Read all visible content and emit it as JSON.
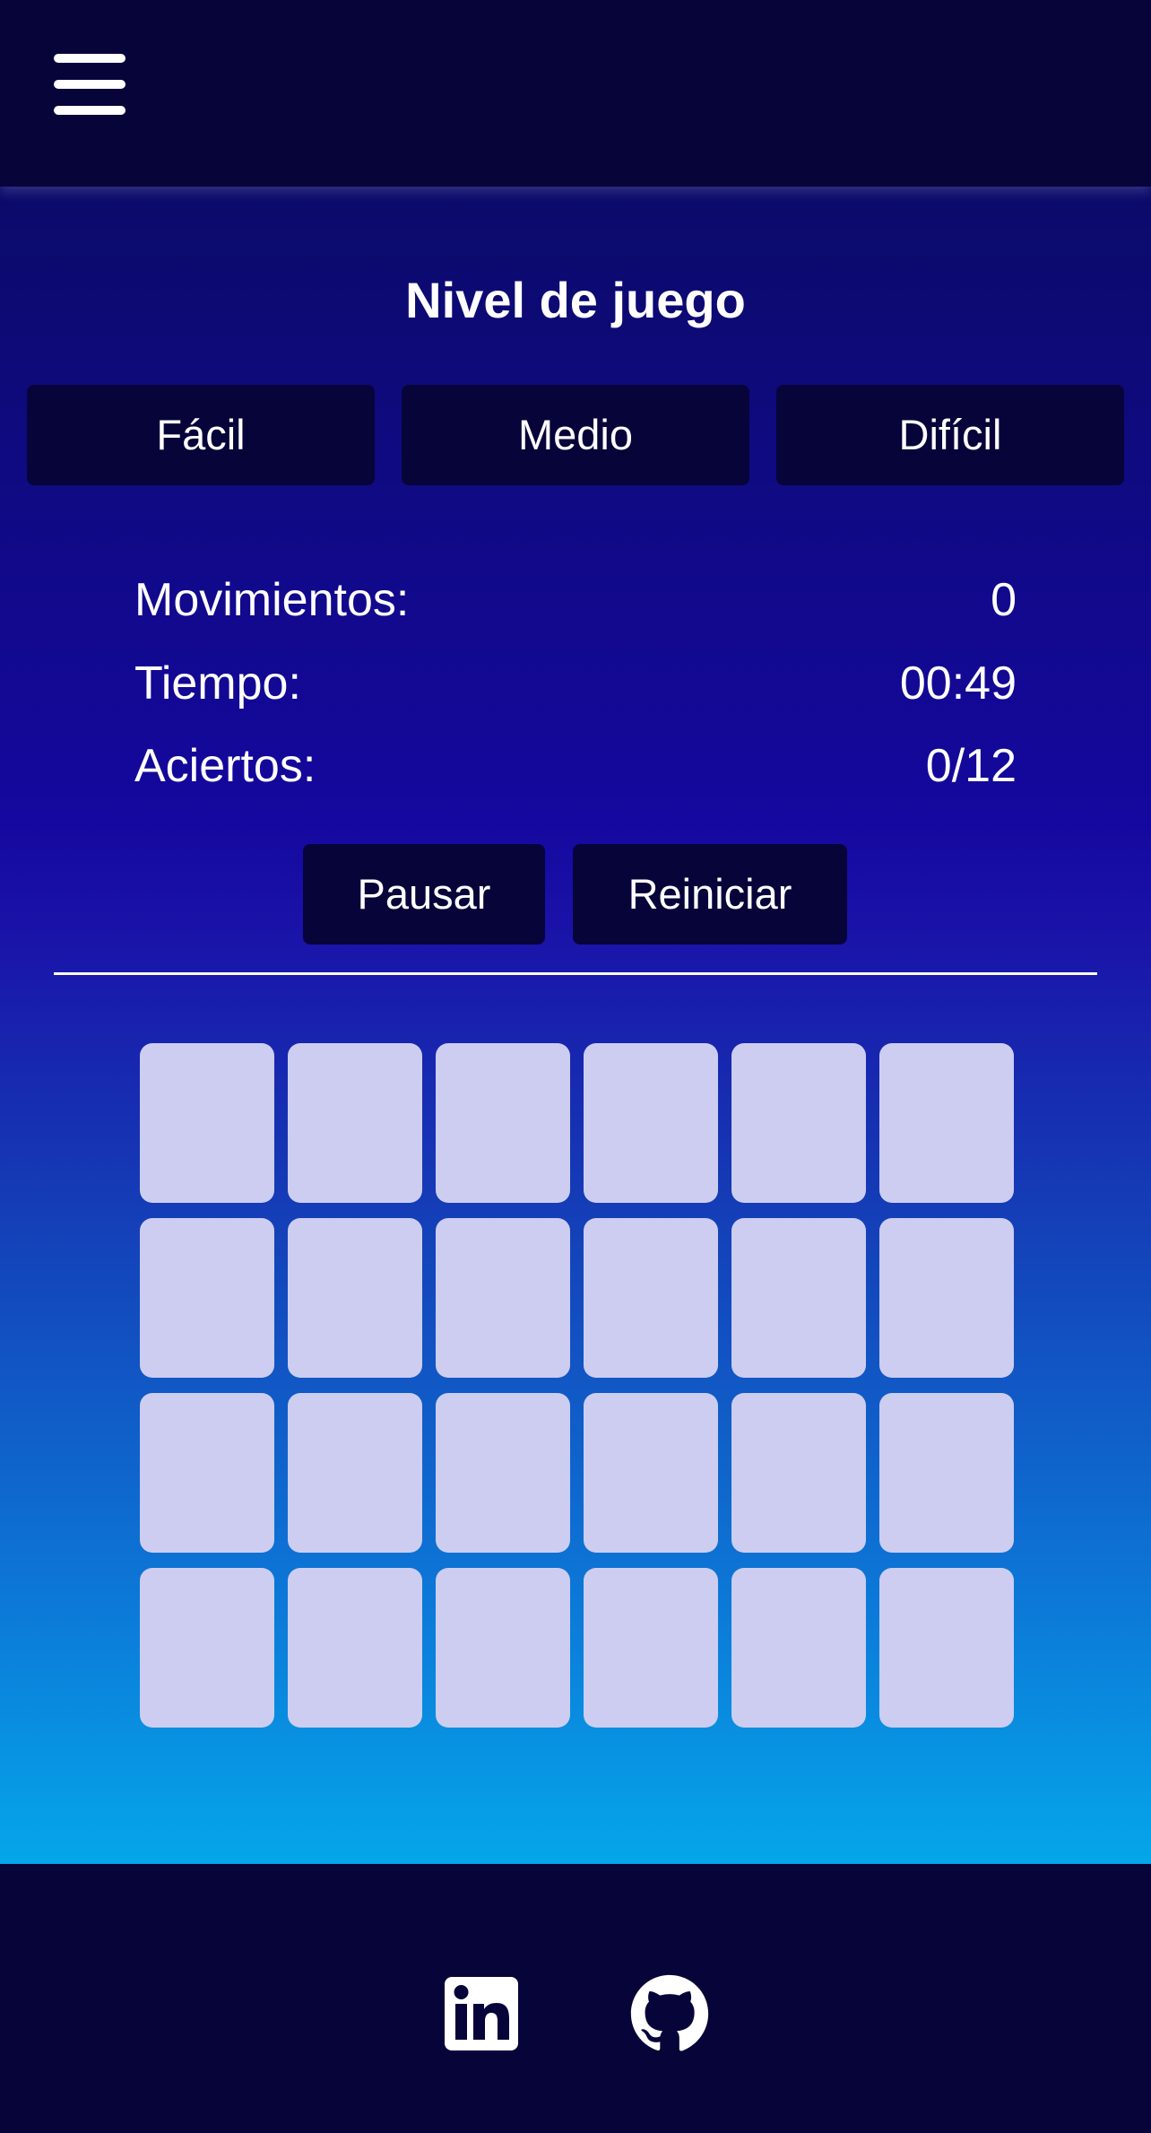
{
  "header": {
    "menu_icon": "hamburger-menu-icon"
  },
  "game": {
    "level_title": "Nivel de juego",
    "levels": [
      "Fácil",
      "Medio",
      "Difícil"
    ],
    "stats": {
      "moves_label": "Movimientos:",
      "moves_value": "0",
      "time_label": "Tiempo:",
      "time_value": "00:49",
      "hits_label": "Aciertos:",
      "hits_value": "0/12"
    },
    "controls": {
      "pause_label": "Pausar",
      "restart_label": "Reiniciar"
    },
    "board": {
      "rows": 4,
      "cols": 6,
      "card_color": "#cccdf1"
    }
  },
  "footer": {
    "icons": [
      "linkedin-icon",
      "github-icon"
    ]
  },
  "colors": {
    "dark_navy": "#07043a",
    "gradient_top": "#0b0b6a",
    "gradient_bottom": "#05a6ea"
  }
}
